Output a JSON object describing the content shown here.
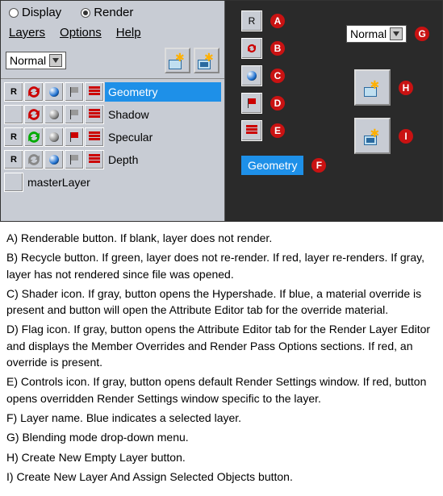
{
  "radios": {
    "display": "Display",
    "render": "Render"
  },
  "menus": {
    "layers": "Layers",
    "options": "Options",
    "help": "Help"
  },
  "blend_mode": "Normal",
  "layers_list": [
    {
      "r": "R",
      "name": "Geometry",
      "selected": true,
      "recycle": "red",
      "sphere": "blue",
      "flag": "gray",
      "ctl": "red"
    },
    {
      "r": "",
      "name": "Shadow",
      "selected": false,
      "recycle": "red",
      "sphere": "gray",
      "flag": "gray",
      "ctl": "red"
    },
    {
      "r": "R",
      "name": "Specular",
      "selected": false,
      "recycle": "green",
      "sphere": "gray",
      "flag": "red",
      "ctl": "red"
    },
    {
      "r": "R",
      "name": "Depth",
      "selected": false,
      "recycle": "gray",
      "sphere": "blue",
      "flag": "gray",
      "ctl": "red"
    }
  ],
  "master_layer_label": "masterLayer",
  "callouts": {
    "A_text": "R",
    "F_text": "Geometry",
    "G_text": "Normal"
  },
  "legend": {
    "A": "A) Renderable button. If blank, layer does not render.",
    "B": "B) Recycle button. If green, layer does not re-render. If red, layer re-renders. If gray, layer has not rendered since file was opened.",
    "C": "C) Shader icon. If gray, button opens the Hypershade. If blue, a material override is present and button will open the Attribute Editor tab for the override material.",
    "D": "D) Flag icon. If gray, button opens the Attribute Editor tab for the Render Layer Editor and displays the Member Overrides and Render Pass Options sections. If red, an override is present.",
    "E": "E) Controls icon. If gray, button opens default Render Settings window. If red, button opens overridden Render Settings window specific to the layer.",
    "F": "F) Layer name. Blue indicates a selected layer.",
    "G": "G) Blending mode drop-down menu.",
    "H": "H) Create New Empty Layer button.",
    "I": "I) Create New Layer And Assign Selected Objects button."
  }
}
